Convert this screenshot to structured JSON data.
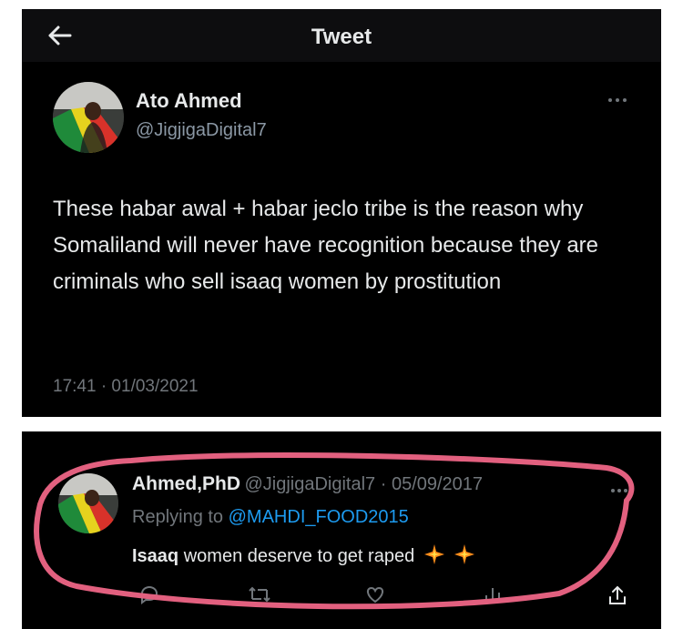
{
  "header": {
    "title": "Tweet"
  },
  "tweet": {
    "display_name": "Ato Ahmed",
    "handle": "@JigjigaDigital7",
    "text": "These habar awal + habar jeclo tribe is the reason why Somaliland will never have recognition because they are criminals who sell isaaq women by prostitution",
    "timestamp": "17:41 · 01/03/2021"
  },
  "reply": {
    "display_name": "Ahmed,PhD",
    "handle_date": "@JigjigaDigital7 · 05/09/2017",
    "replying_prefix": "Replying to",
    "replying_to": "@MAHDI_FOOD2015",
    "text_bold": "Isaaq",
    "text_rest": " women deserve to get raped"
  },
  "colors": {
    "background": "#000000",
    "text": "#e7e9ea",
    "muted": "#71767b",
    "link": "#1d9bf0",
    "highlight_outline": "#e2607f"
  },
  "icons": [
    "back-arrow-icon",
    "more-icon",
    "reply-icon",
    "retweet-icon",
    "like-icon",
    "analytics-icon",
    "share-icon",
    "sparkle-icon"
  ]
}
